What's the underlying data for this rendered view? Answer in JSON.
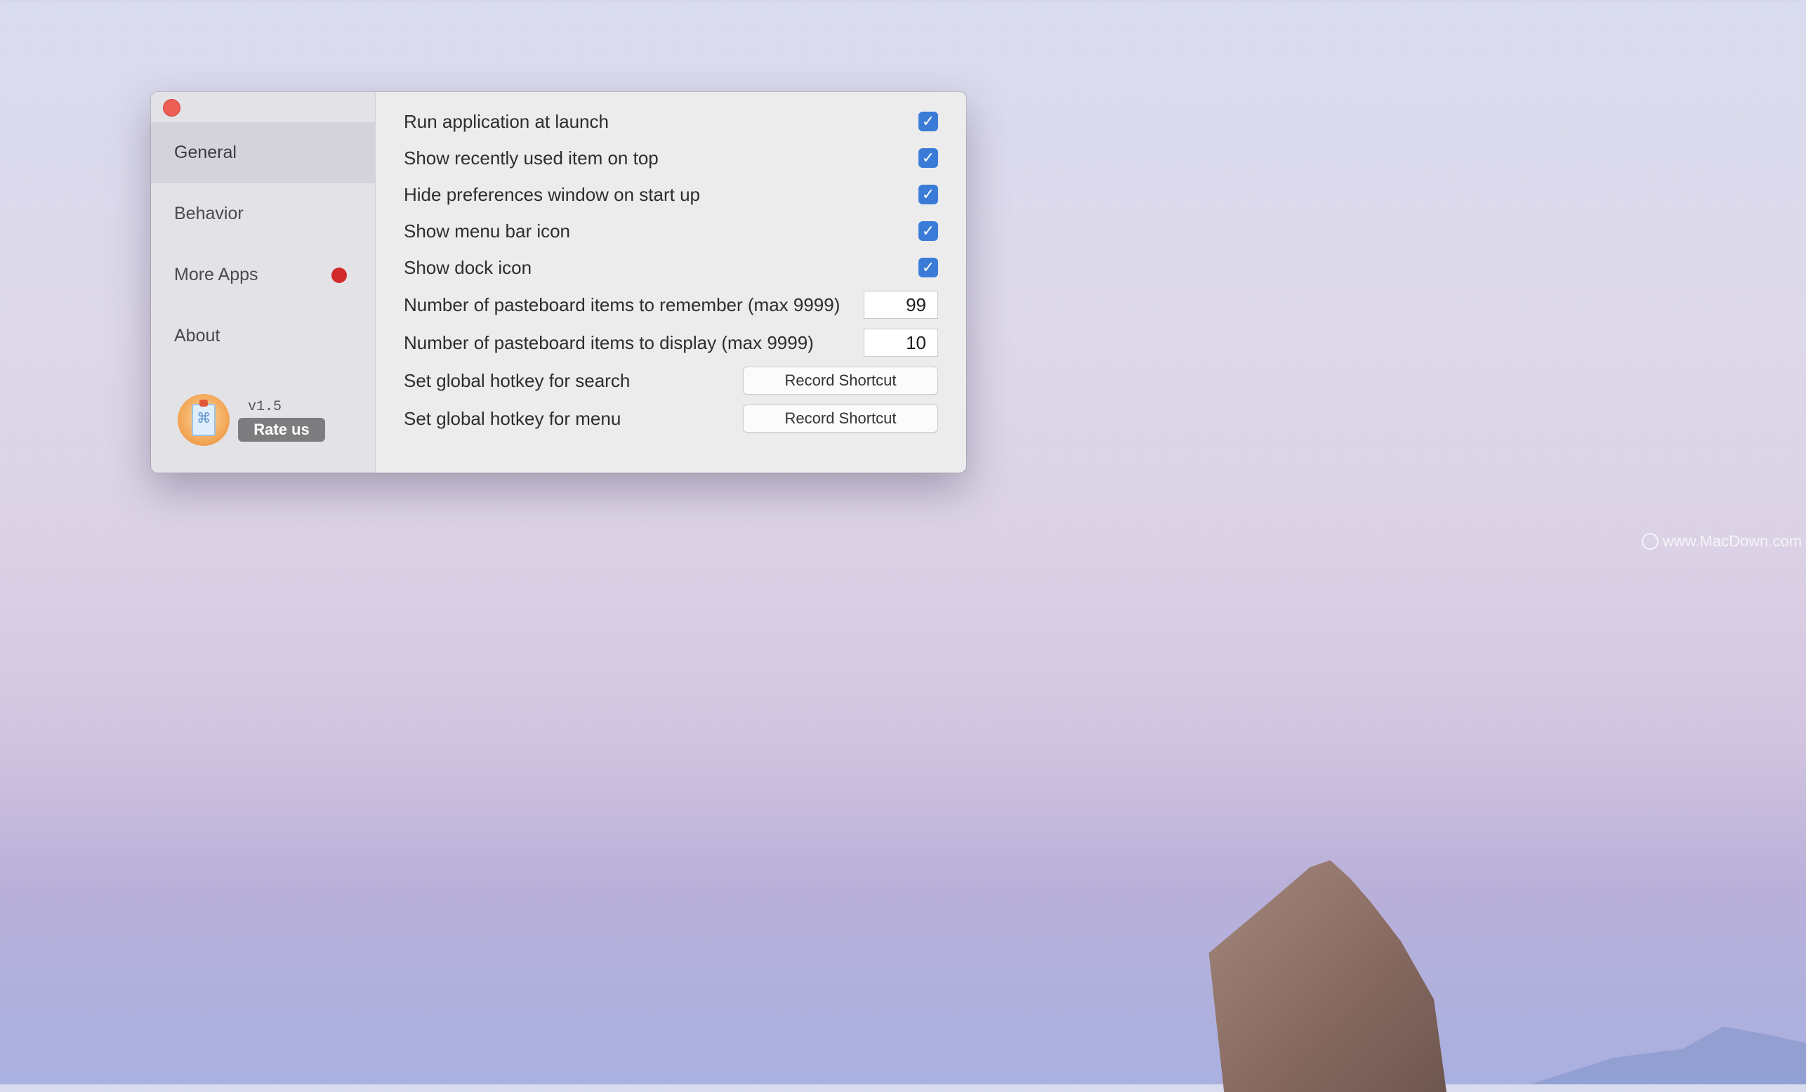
{
  "sidebar": {
    "items": [
      {
        "label": "General",
        "active": true
      },
      {
        "label": "Behavior",
        "active": false
      },
      {
        "label": "More Apps",
        "active": false,
        "badge": "red-dot"
      },
      {
        "label": "About",
        "active": false
      }
    ],
    "version": "v1.5",
    "rate_label": "Rate us"
  },
  "settings": {
    "checkbox_rows": [
      {
        "label": "Run application at launch",
        "checked": true
      },
      {
        "label": "Show recently used item on top",
        "checked": true
      },
      {
        "label": "Hide preferences window on start up",
        "checked": true
      },
      {
        "label": "Show menu bar icon",
        "checked": true
      },
      {
        "label": "Show dock icon",
        "checked": true
      }
    ],
    "remember": {
      "label": "Number of pasteboard items to remember (max 9999)",
      "value": "99"
    },
    "display": {
      "label": "Number of pasteboard items to display (max 9999)",
      "value": "10"
    },
    "hotkey_search": {
      "label": "Set global hotkey for search",
      "button": "Record Shortcut"
    },
    "hotkey_menu": {
      "label": "Set global hotkey for menu",
      "button": "Record Shortcut"
    }
  },
  "watermark": "www.MacDown.com",
  "colors": {
    "accent": "#3a7bd8",
    "close": "#ed5f55",
    "badge": "#d12a2a"
  }
}
